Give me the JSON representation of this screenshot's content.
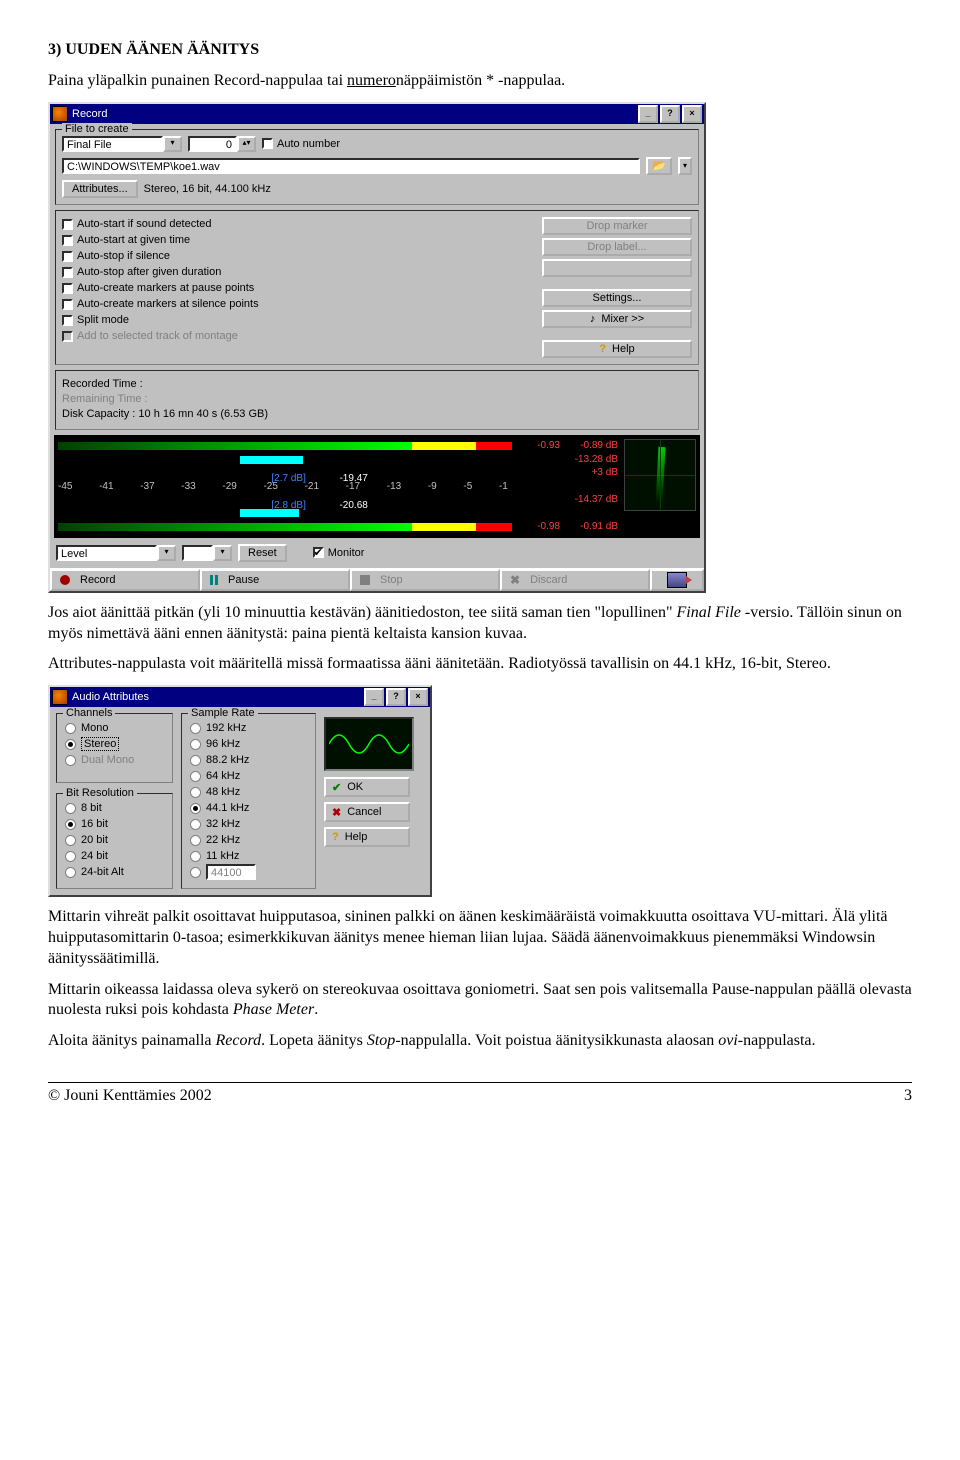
{
  "heading": "3) UUDEN ÄÄNEN ÄÄNITYS",
  "p1a": "Paina yläpalkin punainen Record-nappulaa tai ",
  "p1b": "numero",
  "p1c": "näppäimistön * -nappulaa.",
  "record": {
    "title": "Record",
    "group_file": "File to create",
    "final_file": "Final File",
    "spin_value": "0",
    "auto_number": "Auto number",
    "path": "C:\\WINDOWS\\TEMP\\koe1.wav",
    "attributes_btn": "Attributes...",
    "attr_summary": "Stereo, 16 bit, 44.100 kHz",
    "opts": [
      "Auto-start if sound detected",
      "Auto-start at given time",
      "Auto-stop if silence",
      "Auto-stop after given duration",
      "Auto-create markers at pause points",
      "Auto-create markers at silence points",
      "Split mode",
      "Add to selected track of montage"
    ],
    "drop_marker": "Drop marker",
    "drop_label": "Drop label...",
    "settings": "Settings...",
    "mixer": "Mixer >>",
    "help": "Help",
    "recorded_time_lbl": "Recorded Time :",
    "remaining_time_lbl": "Remaining Time :",
    "disk_cap": "Disk Capacity : 10 h 16 mn 40 s (6.53 GB)",
    "blue1": "[2.7 dB]",
    "blue2": "[2.8 dB]",
    "peak1": "-19.47",
    "peak2": "-20.68",
    "r1": "-0.93",
    "r1b": "-0.89 dB",
    "r2": "-13.28 dB",
    "r3": "+3 dB",
    "r4": "-14.37 dB",
    "r5": "-0.98",
    "r5b": "-0.91 dB",
    "scale": [
      "-45",
      "-41",
      "-37",
      "-33",
      "-29",
      "-25",
      "-21",
      "-17",
      "-13",
      "-9",
      "-5",
      "-1"
    ],
    "level_lbl": "Level",
    "reset": "Reset",
    "monitor": "Monitor",
    "record_btn": "Record",
    "pause_btn": "Pause",
    "stop_btn": "Stop",
    "discard_btn": "Discard"
  },
  "p2a": "Jos aiot äänittää pitkän (yli 10 minuuttia kestävän) äänitiedoston, tee siitä saman tien \"lopullinen\" ",
  "p2b": "Final File",
  "p2c": " -versio. Tällöin sinun on myös nimettävä ääni ennen äänitystä: paina pientä keltaista kansion kuvaa.",
  "p3": "Attributes-nappulasta voit määritellä missä formaatissa ääni äänitetään. Radiotyössä tavallisin on 44.1 kHz, 16-bit, Stereo.",
  "aa": {
    "title": "Audio Attributes",
    "channels_lbl": "Channels",
    "channels": [
      "Mono",
      "Stereo",
      "Dual Mono"
    ],
    "sr_lbl": "Sample Rate",
    "sr": [
      "192 kHz",
      "96 kHz",
      "88.2 kHz",
      "64 kHz",
      "48 kHz",
      "44.1 kHz",
      "32 kHz",
      "22 kHz",
      "11 kHz"
    ],
    "sr_custom": "44100",
    "bit_lbl": "Bit Resolution",
    "bits": [
      "8 bit",
      "16 bit",
      "20 bit",
      "24 bit",
      "24-bit Alt"
    ],
    "ok": "OK",
    "cancel": "Cancel",
    "help": "Help"
  },
  "p4a": "Mittarin vihreät palkit osoittavat huipputasoa, sininen palkki on äänen keskimääräistä voimakkuutta osoittava VU-mittari. Älä ylitä huipputasomittarin 0-tasoa; esimerkkikuvan äänitys menee hieman liian lujaa. Säädä äänenvoimakkuus pienemmäksi Windowsin äänityssäätimillä.",
  "p5a": "Mittarin oikeassa laidassa oleva sykerö on stereokuvaa osoittava goniometri. Saat sen pois valitsemalla Pause-nappulan päällä olevasta nuolesta ruksi pois kohdasta ",
  "p5b": "Phase Meter",
  "p5c": ".",
  "p6a": "Aloita äänitys painamalla ",
  "p6b": "Record",
  "p6c": ". Lopeta äänitys ",
  "p6d": "Stop",
  "p6e": "-nappulalla. Voit poistua äänitysikkunasta alaosan ",
  "p6f": "ovi",
  "p6g": "-nappulasta.",
  "copyright": "© Jouni Kenttämies 2002",
  "pagenum": "3"
}
